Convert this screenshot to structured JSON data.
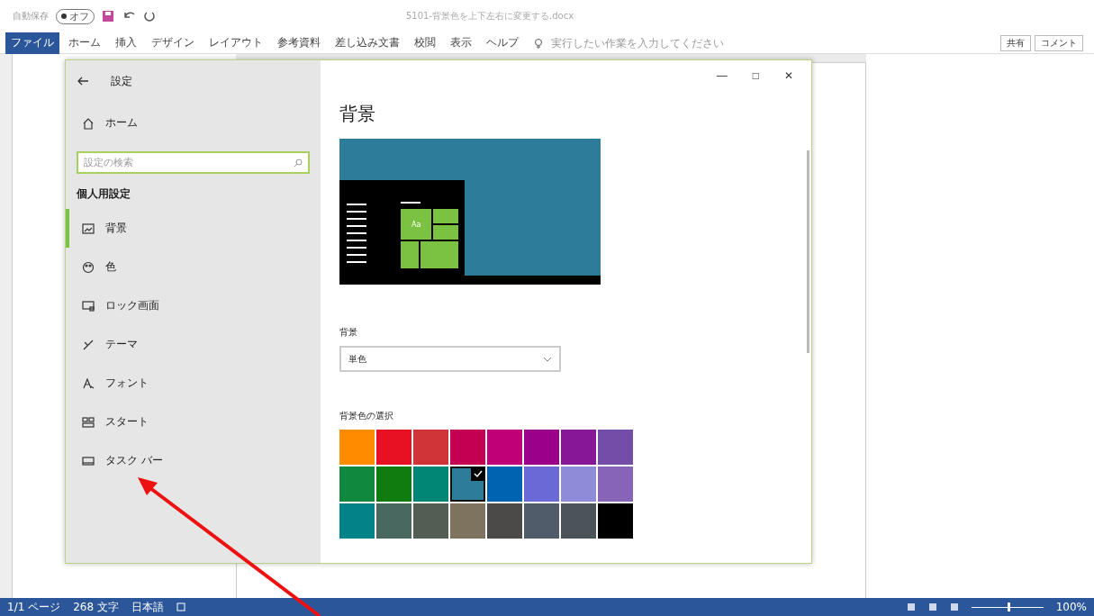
{
  "title_bar": {
    "autosave_label": "自動保存",
    "autosave": {
      "label": "オフ",
      "on": false
    },
    "file_name": "5101-背景色を上下左右に変更する.docx"
  },
  "ribbon": {
    "tabs": [
      {
        "label": "ファイル",
        "selected": true
      },
      {
        "label": "ホーム",
        "selected": false
      },
      {
        "label": "挿入",
        "selected": false
      },
      {
        "label": "デザイン",
        "selected": false
      },
      {
        "label": "レイアウト",
        "selected": false
      },
      {
        "label": "参考資料",
        "selected": false
      },
      {
        "label": "差し込み文書",
        "selected": false
      },
      {
        "label": "校閲",
        "selected": false
      },
      {
        "label": "表示",
        "selected": false
      },
      {
        "label": "ヘルプ",
        "selected": false
      }
    ],
    "search": {
      "placeholder": "実行したい作業を入力してください"
    },
    "buttons": [
      "共有",
      "コメント"
    ]
  },
  "settings": {
    "title": "設定",
    "home": "ホーム",
    "search": {
      "placeholder": "設定の検索"
    },
    "section": "個人用設定",
    "window_controls": [
      "—",
      "□",
      "✕"
    ],
    "nav": [
      {
        "label": "背景",
        "selected": true
      },
      {
        "label": "色",
        "selected": false
      },
      {
        "label": "ロック画面",
        "selected": false
      },
      {
        "label": "テーマ",
        "selected": false
      },
      {
        "label": "フォント",
        "selected": false
      },
      {
        "label": "スタート",
        "selected": false
      },
      {
        "label": "タスク バー",
        "selected": false
      }
    ],
    "heading": "背景",
    "preview_tile": "Aa",
    "background_label": "背景",
    "background_value": "単色",
    "color_label": "背景色の選択",
    "colors": [
      {
        "color": "#ff8c00",
        "selected": false
      },
      {
        "color": "#e81123",
        "selected": false
      },
      {
        "color": "#d13438",
        "selected": false
      },
      {
        "color": "#c30052",
        "selected": false
      },
      {
        "color": "#bf0077",
        "selected": false
      },
      {
        "color": "#9a0089",
        "selected": false
      },
      {
        "color": "#881798",
        "selected": false
      },
      {
        "color": "#744da9",
        "selected": false
      },
      {
        "color": "#10893e",
        "selected": false
      },
      {
        "color": "#107c10",
        "selected": false
      },
      {
        "color": "#018574",
        "selected": false
      },
      {
        "color": "#2d7d9a",
        "selected": true
      },
      {
        "color": "#0063b1",
        "selected": false
      },
      {
        "color": "#6b69d6",
        "selected": false
      },
      {
        "color": "#8e8cd8",
        "selected": false
      },
      {
        "color": "#8764b8",
        "selected": false
      },
      {
        "color": "#038387",
        "selected": false
      },
      {
        "color": "#486860",
        "selected": false
      },
      {
        "color": "#525e54",
        "selected": false
      },
      {
        "color": "#7e735f",
        "selected": false
      },
      {
        "color": "#4c4a48",
        "selected": false
      },
      {
        "color": "#515c6b",
        "selected": false
      },
      {
        "color": "#4a5459",
        "selected": false
      },
      {
        "color": "#000000",
        "selected": false
      }
    ]
  },
  "status_bar": {
    "page": "1/1 ページ",
    "words": "268 文字",
    "language": "日本語",
    "zoom": "100%",
    "zoom_level": {
      "level": 0.5
    }
  }
}
